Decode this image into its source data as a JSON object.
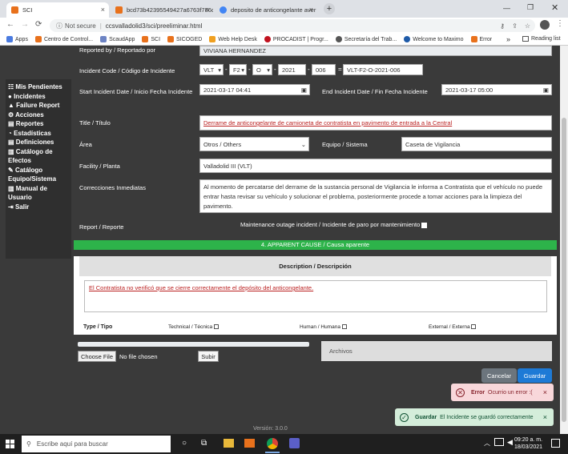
{
  "browser": {
    "tabs": [
      {
        "title": "SCI",
        "close": "×"
      },
      {
        "title": "bcd73b42395549427a6763f786d",
        "close": "×"
      },
      {
        "title": "deposito de anticongelante aver",
        "close": "×"
      }
    ],
    "new_tab": "+",
    "security": "Not secure",
    "separator": "|",
    "url": "ccsvalladolid3/sci/preeliminar.html",
    "bookmarks": [
      {
        "label": "Apps",
        "color": "#4a7be0"
      },
      {
        "label": "Centro de Control...",
        "color": "#e8711c"
      },
      {
        "label": "ScaudApp",
        "color": "#6d84c4"
      },
      {
        "label": "SCI",
        "color": "#e8711c"
      },
      {
        "label": "SICOGED",
        "color": "#e8711c"
      },
      {
        "label": "Web Help Desk",
        "color": "#f0a020"
      },
      {
        "label": "PROCADIST | Progr...",
        "color": "#c1121f"
      },
      {
        "label": "Secretaría del Trab...",
        "color": "#555555"
      },
      {
        "label": "Welcome to Maximo",
        "color": "#1e5aa8"
      },
      {
        "label": "Error",
        "color": "#e8711c"
      }
    ],
    "more": "»",
    "reading_list": "Reading list"
  },
  "sidebar": {
    "items": [
      "Mis Pendientes",
      "Incidentes",
      "Failure Report",
      "Acciones",
      "Reportes",
      "Estadísticas",
      "Definiciones",
      "Catálogo de Efectos",
      "Catálogo Equipo/Sistema",
      "Manual de Usuario",
      "Salir"
    ]
  },
  "form": {
    "reported_by_label": "Reported by / Reportado por",
    "reported_by_value": "VIVIANA HERNANDEZ",
    "incident_code_label": "Incident Code / Código de Incidente",
    "code_parts": [
      "VLT",
      "F2",
      "O",
      "2021",
      "006"
    ],
    "code_equals": "=",
    "code_full": "VLT-F2-O-2021-006",
    "start_date_label": "Start Incident Date / Inicio Fecha Incidente",
    "start_date_value": "2021-03-17 04:41",
    "end_date_label": "End Incident Date / Fin Fecha Incidente",
    "end_date_value": "2021-03-17 05:00",
    "title_label": "Title / Título",
    "title_value": "Derrame de anticongelante de camioneta de contratista en pavimento de entrada a la Central",
    "area_label": "Área",
    "area_value": "Otros / Others",
    "equipo_label": "Equipo / Sistema",
    "equipo_value": "Caseta de Vigilancia",
    "facility_label": "Facility / Planta",
    "facility_value": "Valladolid III (VLT)",
    "correcciones_label": "Correcciones Inmediatas",
    "correcciones_value": "Al momento de percatarse del derrame de la sustancia personal de Vigilancia le informa a Contratista que el vehículo no puede entrar hasta revisar su vehículo y solucionar el problema, posteriormente procede a tomar acciones para la limpieza del pavimento.",
    "report_label": "Report / Reporte",
    "maintenance_label": "Maintenance outage incident / Incidente de paro por mantenimiento"
  },
  "apparent_cause": {
    "header": "4. APPARENT CAUSE / Causa aparente",
    "desc_header": "Description / Descripción",
    "desc_value": "El Contratista no verificó que se cierre correctamente el depósito del anticongelante.",
    "type_label": "Type / Tipo",
    "types": [
      "Technical / Técnica",
      "Human / Humana",
      "External / Externa"
    ]
  },
  "files": {
    "choose": "Choose File",
    "none": "No file chosen",
    "upload": "Subir",
    "archivos": "Archivos"
  },
  "actions": {
    "cancel": "Cancelar",
    "save": "Guardar"
  },
  "toasts": {
    "error_title": "Error",
    "error_msg": "Ocurrio un error :(",
    "ok_title": "Guardar",
    "ok_msg": "El Incidente se guardó correctamente",
    "close": "×"
  },
  "version": "Versión: 3.0.0",
  "taskbar": {
    "search": "Escribe aquí para buscar",
    "time": "09:20 a. m.",
    "date": "18/03/2021"
  },
  "colors": {
    "accent": "#1e7ad6",
    "green": "#2db34a",
    "error_bg": "#f8d7da",
    "success_bg": "#d4edda"
  }
}
